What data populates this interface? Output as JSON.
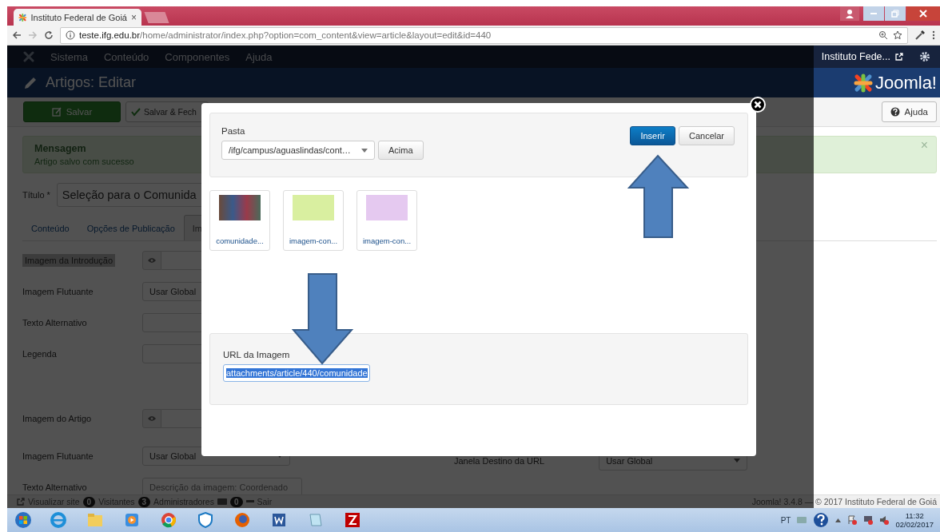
{
  "browser": {
    "tab": {
      "title": "Instituto Federal de Goiá",
      "selected": true,
      "close": "×"
    },
    "url_host": "teste.ifg.edu.br",
    "url_path": "/home/administrator/index.php?option=com_content&view=article&layout=edit&id=440"
  },
  "admin": {
    "menu": [
      "Sistema",
      "Conteúdo",
      "Componentes",
      "Ajuda"
    ],
    "site_link": "Instituto Fede...",
    "page_title": "Artigos: Editar",
    "logo_text": "Joomla!"
  },
  "toolbar": [
    {
      "label": "Salvar",
      "kind": "save"
    },
    {
      "label": "Salvar & Fech",
      "kind": "save-close"
    }
  ],
  "help_button": "Ajuda",
  "message": {
    "heading": "Mensagem",
    "text": "Artigo salvo com sucesso",
    "close": "×"
  },
  "title_field": {
    "label": "Título *",
    "value": "Seleção para o Comunida"
  },
  "tabs": [
    {
      "label": "Conteúdo",
      "selected": false
    },
    {
      "label": "Opções de Publicação",
      "selected": false
    },
    {
      "label": "Im",
      "selected": true
    }
  ],
  "fields": [
    {
      "label": "Imagem da Introdução",
      "kind": "media",
      "highlighted": true
    },
    {
      "label": "Imagem Flutuante",
      "kind": "select",
      "value": "Usar Global",
      "highlighted": false
    },
    {
      "label": "Texto Alternativo",
      "kind": "text",
      "highlighted": false
    },
    {
      "label": "Legenda",
      "kind": "text",
      "highlighted": false
    },
    {
      "kind": "spacer"
    },
    {
      "label": "Imagem do Artigo",
      "kind": "media",
      "highlighted": false
    },
    {
      "label": "Imagem Flutuante",
      "kind": "select",
      "value": "Usar Global",
      "highlighted": false,
      "aside": {
        "label": "Janela Destino da URL",
        "value": "Usar Global"
      }
    },
    {
      "label": "Texto Alternativo",
      "kind": "text",
      "placeholder": "Descrição da imagem: Coordenado",
      "highlighted": false
    }
  ],
  "status_bar": {
    "view_site": "Visualizar site",
    "counters": [
      {
        "count": "0",
        "label": "Visitantes"
      },
      {
        "count": "3",
        "label": "Administradores"
      },
      {
        "count": "0",
        "label": "Sair"
      }
    ],
    "right": "Joomla! 3.4.8 — © 2017 Instituto Federal de Goiá"
  },
  "modal": {
    "folder_label": "Pasta",
    "folder": "/ifg/campus/aguaslindas/cont…",
    "up_button": "Acima",
    "insert_button": "Inserir",
    "cancel_button": "Cancelar",
    "images": [
      {
        "name": "comunidade...",
        "kind": "photo"
      },
      {
        "name": "imagem-con...",
        "kind": "note",
        "color": "#d9efa0"
      },
      {
        "name": "imagem-con...",
        "kind": "note",
        "color": "#e5c9f0"
      }
    ],
    "url_label": "URL da Imagem",
    "url_value": "attachments/article/440/comunidade",
    "url_text_selected": true
  },
  "annotations": [
    {
      "kind": "up"
    },
    {
      "kind": "down"
    }
  ],
  "taskbar": {
    "apps": [
      {
        "kind": "start"
      },
      {
        "kind": "ie"
      },
      {
        "kind": "folder"
      },
      {
        "kind": "media"
      },
      {
        "kind": "chrome"
      },
      {
        "kind": "shield"
      },
      {
        "kind": "firefox"
      },
      {
        "kind": "word"
      },
      {
        "kind": "notepad"
      },
      {
        "kind": "filezilla"
      }
    ],
    "language": "PT",
    "time": "11:32",
    "date": "02/02/2017"
  }
}
